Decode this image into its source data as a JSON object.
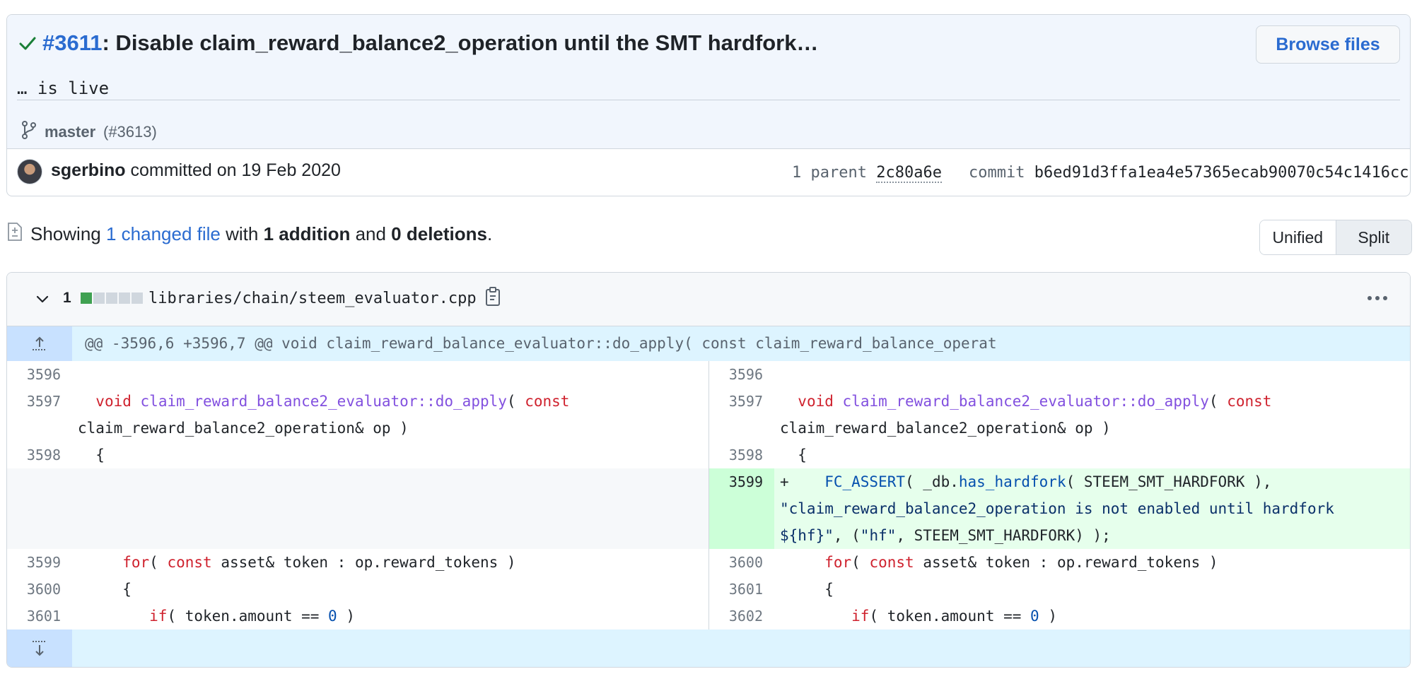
{
  "commit": {
    "pr_number": "#3611",
    "title": ": Disable claim_reward_balance2_operation until the SMT hardfork…",
    "description": "… is live",
    "browse_label": "Browse files",
    "branch": "master",
    "branch_pr": "(#3613)",
    "author": "sgerbino",
    "committed_text": " committed on 19 Feb 2020",
    "parent_label": "1 parent ",
    "parent_sha": "2c80a6e",
    "commit_label": "commit ",
    "commit_sha": "b6ed91d3ffa1ea4e57365ecab90070c54c1416cc"
  },
  "summary": {
    "prefix": "Showing ",
    "changed": "1 changed file",
    "with": " with ",
    "additions": "1 addition",
    "and": " and ",
    "deletions": "0 deletions",
    "period": "."
  },
  "view_toggle": {
    "unified": "Unified",
    "split": "Split",
    "active": "Split"
  },
  "file": {
    "change_count": "1",
    "path": "libraries/chain/steem_evaluator.cpp",
    "hunk": "@@ -3596,6 +3596,7 @@ void claim_reward_balance_evaluator::do_apply( const claim_reward_balance_operat",
    "left": [
      {
        "ln": "3596"
      },
      {
        "ln": "3597"
      },
      {
        "ln": "3598",
        "code": "  {"
      },
      {
        "ln": "3599"
      },
      {
        "ln": "3600",
        "code": "     {"
      },
      {
        "ln": "3601"
      }
    ],
    "right": [
      {
        "ln": "3596"
      },
      {
        "ln": "3597"
      },
      {
        "ln": "3598",
        "code": "  {"
      },
      {
        "ln": "3599"
      },
      {
        "ln": "3600"
      },
      {
        "ln": "3601",
        "code": "     {"
      },
      {
        "ln": "3602"
      }
    ]
  },
  "colors": {
    "link": "#2a6bd0",
    "addition_bg": "#e6ffec",
    "addition_gutter": "#ccffd8",
    "hunk_bg": "#ddf4ff",
    "keyword": "#cf222e",
    "function": "#8250df",
    "constant": "#0550ae"
  },
  "icons": [
    "check-icon",
    "git-branch-icon",
    "avatar",
    "file-diff-icon",
    "chevron-down-icon",
    "clipboard-icon",
    "kebab-horizontal-icon",
    "unfold-up-icon",
    "unfold-down-icon"
  ]
}
